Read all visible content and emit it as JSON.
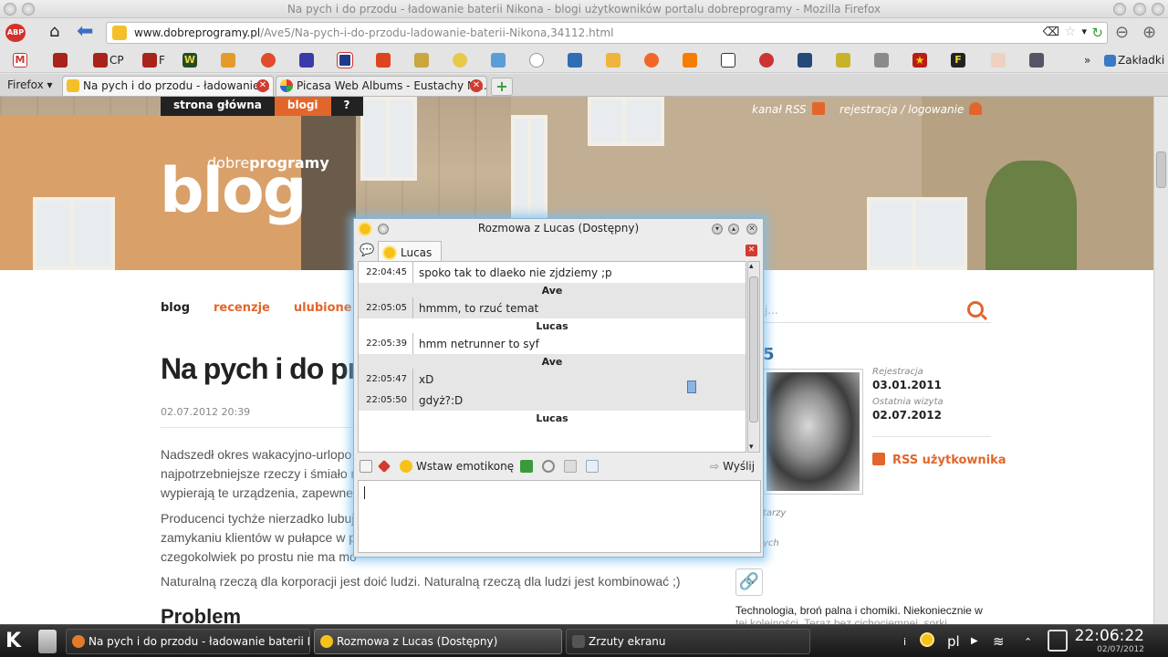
{
  "firefox": {
    "window_title": "Na pych i do przodu - ładowanie baterii Nikona - blogi użytkowników portalu dobreprogramy - Mozilla Firefox",
    "url_domain": "www.dobreprogramy.pl",
    "url_path": "/Ave5/Na-pych-i-do-przodu-ladowanie-baterii-Nikona,34112.html",
    "bookmarks": [
      {
        "label": "CP",
        "icon": "fox-icon"
      },
      {
        "label": "F",
        "icon": "fox-icon"
      }
    ],
    "bookmarks_folder": "Zakładki",
    "firefox_menu": "Firefox",
    "tabs": [
      {
        "label": "Na pych i do przodu - ładowanie...",
        "active": true
      },
      {
        "label": "Picasa Web Albums - Eustachy M...",
        "active": false
      }
    ]
  },
  "site": {
    "topnav": [
      "strona główna",
      "blogi",
      "?"
    ],
    "brand_small_regular": "dobre",
    "brand_small_bold": "programy",
    "brand_big": "blog",
    "rss_channel": "kanał RSS",
    "register_login": "rejestracja / logowanie",
    "subnav": [
      "blog",
      "recenzje",
      "ulubione progra"
    ],
    "search_placeholder": "j...",
    "post_title": "Na pych i do przod",
    "post_date": "02.07.2012 20:39",
    "paragraphs": [
      "Nadszedł okres wakacyjno-urlopo",
      "najpotrzebniejsze rzeczy i śmiało r",
      "wypierają te urządzenia, zapewne",
      "Producenci tychże nierzadko lubuj",
      "zamykaniu klientów w pułapce w p",
      "czegokolwiek po prostu nie ma mo",
      "Naturalną rzeczą dla korporacji jest doić ludzi. Naturalną rzeczą dla ludzi jest kombinować ;)"
    ],
    "section_heading": "Problem",
    "user_head": "5",
    "registration_label": "Rejestracja",
    "registration_value": "03.01.2011",
    "last_visit_label": "Ostatnia wizyta",
    "last_visit_value": "02.07.2012",
    "rss_user": "RSS użytkownika",
    "side_small_1": "tarzy",
    "side_small_2": "ych",
    "side_text_1": "Technologia, broń palna i chomiki. Niekoniecznie w",
    "side_text_2": "tej kolejności. Teraz bez cichociemnej, sorki."
  },
  "chat": {
    "title": "Rozmowa z Lucas (Dostępny)",
    "tab_label": "Lucas",
    "messages": [
      {
        "sender": "",
        "alt": false,
        "lines": [
          {
            "time": "22:04:45",
            "text": "spoko tak to dlaeko nie zjdziemy ;p"
          }
        ]
      },
      {
        "sender": "Ave",
        "alt": true,
        "lines": [
          {
            "time": "22:05:05",
            "text": "hmmm, to rzuć temat"
          }
        ]
      },
      {
        "sender": "Lucas",
        "alt": false,
        "lines": [
          {
            "time": "22:05:39",
            "text": "hmm netrunner to syf"
          }
        ]
      },
      {
        "sender": "Ave",
        "alt": true,
        "lines": [
          {
            "time": "22:05:47",
            "text": "xD"
          },
          {
            "time": "22:05:50",
            "text": "gdyż?:D"
          }
        ]
      },
      {
        "sender": "Lucas",
        "alt": false,
        "lines": []
      }
    ],
    "emoticon_label": "Wstaw emotikonę",
    "send_label": "Wyślij"
  },
  "taskbar": {
    "tasks": [
      {
        "label": "Na pych i do przodu - ładowanie baterii Niko",
        "active": false
      },
      {
        "label": "Rozmowa z Lucas (Dostępny)",
        "active": true
      },
      {
        "label": "Zrzuty ekranu",
        "active": false
      }
    ],
    "keyboard_layout": "pl",
    "time": "22:06:22",
    "date": "02/07/2012"
  },
  "colors": {
    "accent_orange": "#e2662c",
    "taskbar_dark": "#1f1f1f",
    "chat_glow": "#7cc0f0"
  }
}
